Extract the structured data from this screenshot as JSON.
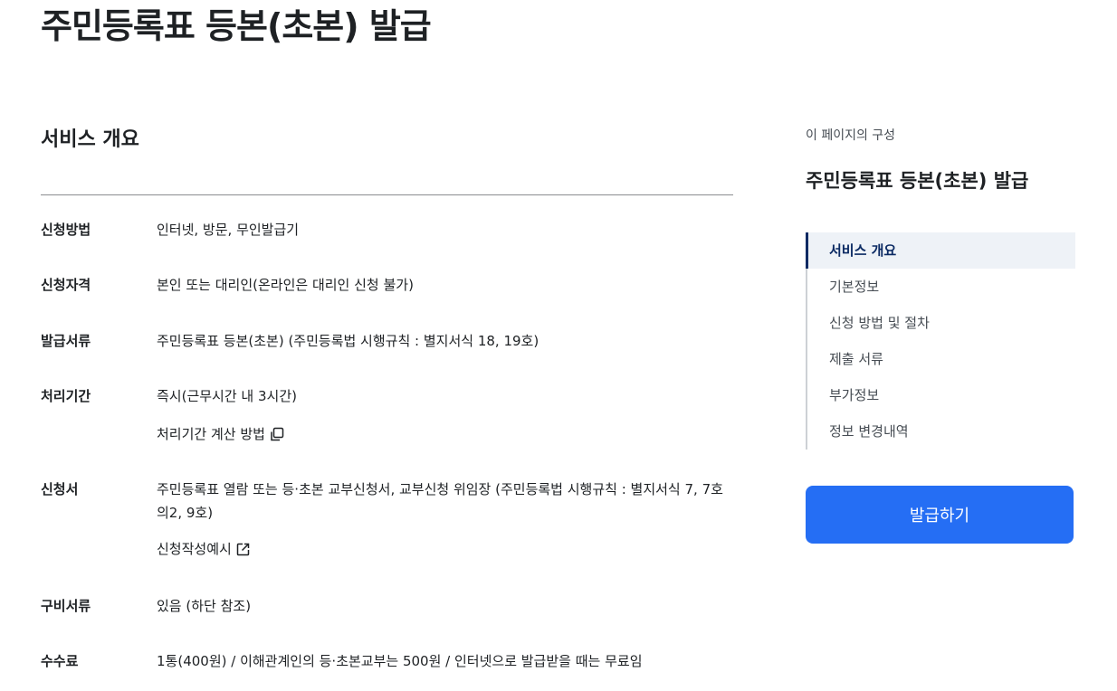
{
  "page": {
    "title": "주민등록표 등본(초본) 발급"
  },
  "overview": {
    "section_title": "서비스 개요",
    "rows": [
      {
        "label": "신청방법",
        "value": "인터넷, 방문, 무인발급기"
      },
      {
        "label": "신청자격",
        "value": "본인 또는 대리인(온라인은 대리인 신청 불가)"
      },
      {
        "label": "발급서류",
        "value": "주민등록표 등본(초본) (주민등록법 시행규칙 : 별지서식 18, 19호)"
      },
      {
        "label": "처리기간",
        "value": "즉시(근무시간 내 3시간)",
        "link": "처리기간 계산 방법",
        "link_icon": "copy-icon"
      },
      {
        "label": "신청서",
        "value": "주민등록표 열람 또는 등·초본 교부신청서, 교부신청 위임장 (주민등록법 시행규칙 : 별지서식 7, 7호의2, 9호)",
        "link": "신청작성예시",
        "link_icon": "external-link-icon"
      },
      {
        "label": "구비서류",
        "value": "있음 (하단 참조)"
      },
      {
        "label": "수수료",
        "value": "1통(400원) / 이해관계인의 등·초본교부는 500원 / 인터넷으로 발급받을 때는 무료임"
      }
    ]
  },
  "aside": {
    "caption": "이 페이지의 구성",
    "title": "주민등록표 등본(초본) 발급",
    "toc": [
      {
        "label": "서비스 개요",
        "active": true
      },
      {
        "label": "기본정보",
        "active": false
      },
      {
        "label": "신청 방법 및 절차",
        "active": false
      },
      {
        "label": "제출 서류",
        "active": false
      },
      {
        "label": "부가정보",
        "active": false
      },
      {
        "label": "정보 변경내역",
        "active": false
      }
    ],
    "issue_button_label": "발급하기"
  },
  "colors": {
    "primary": "#256ef4",
    "toc_active_text": "#0b2a63",
    "toc_active_bg": "#eef2f7"
  }
}
